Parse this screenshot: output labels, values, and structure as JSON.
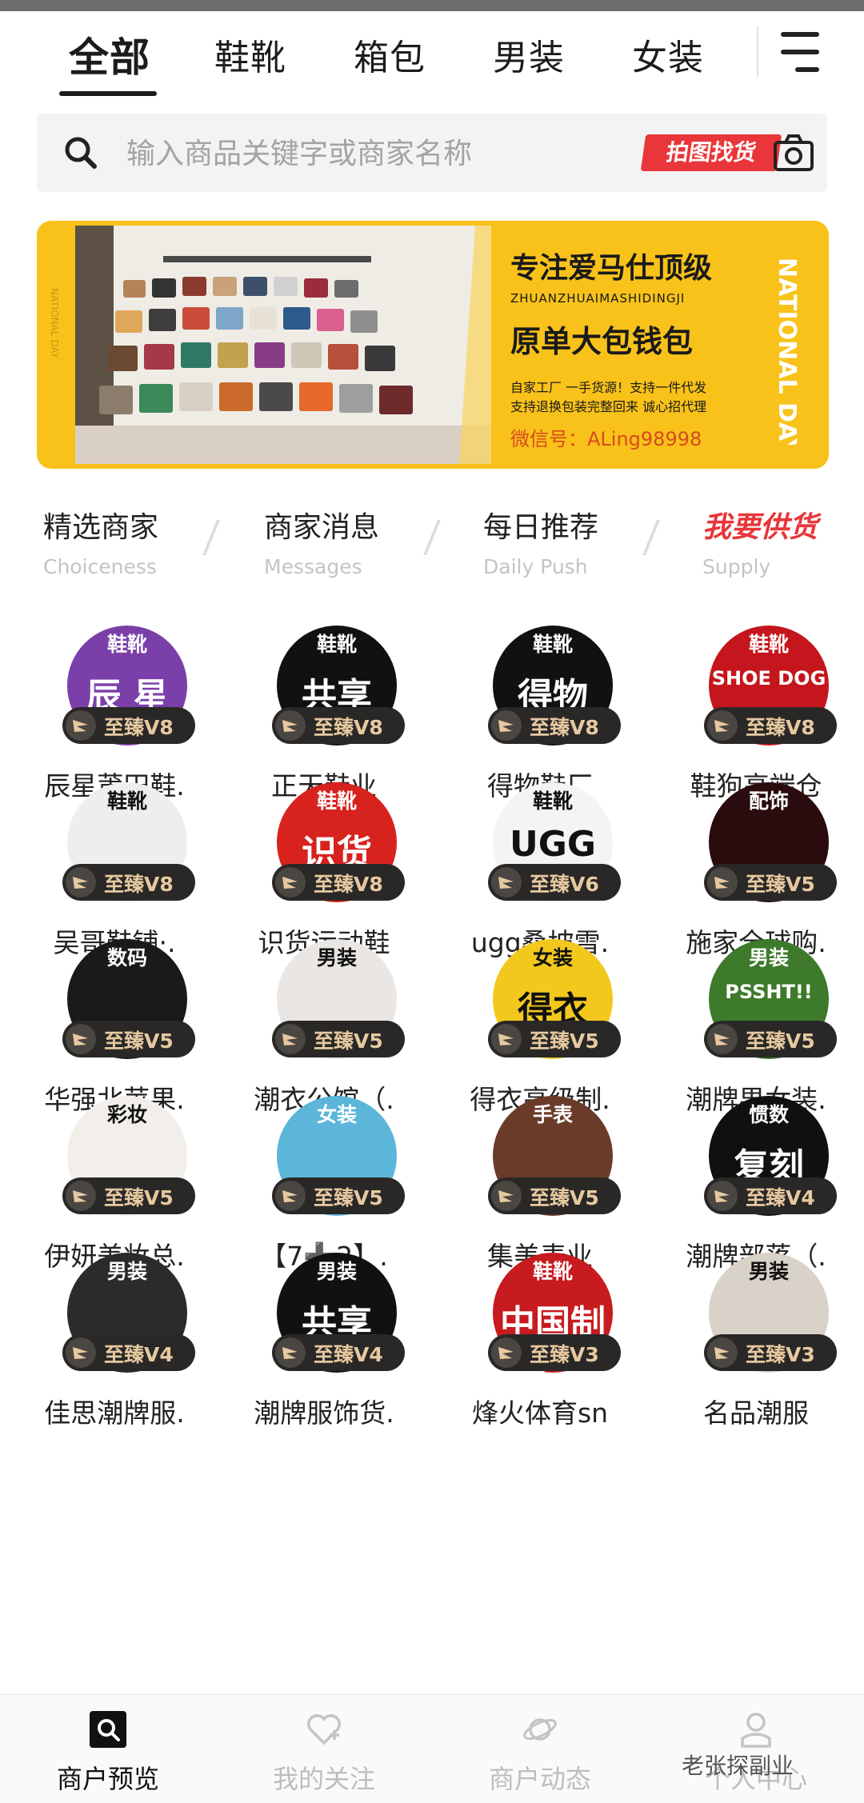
{
  "tabs": [
    {
      "label": "全部"
    },
    {
      "label": "鞋靴"
    },
    {
      "label": "箱包"
    },
    {
      "label": "男装"
    },
    {
      "label": "女装"
    }
  ],
  "search": {
    "placeholder": "输入商品关键字或商家名称",
    "photo_search_label": "拍图找货"
  },
  "banner": {
    "title": "专注爱马仕顶级",
    "pinyin": "ZHUANZHUAIMASHIDINGJI",
    "subtitle": "原单大包钱包",
    "desc1": "自家工厂 一手货源！支持一件代发",
    "desc2": "支持退换包装完整回来 诚心招代理",
    "wechat": "微信号：ALing98998",
    "side_text": "NATIONAL DAY",
    "side_text_left": "NATIONAL DAY"
  },
  "sections": [
    {
      "title": "精选商家",
      "sub": "Choiceness"
    },
    {
      "title": "商家消息",
      "sub": "Messages"
    },
    {
      "title": "每日推荐",
      "sub": "Daily Push"
    },
    {
      "title": "我要供货",
      "sub": "Supply"
    }
  ],
  "merchants": [
    {
      "name": "辰星莆田鞋.",
      "badge": "至臻V8",
      "tag": "鞋靴",
      "logo": "辰 星",
      "bg": "#7a3fa8"
    },
    {
      "name": "正天鞋业",
      "badge": "至臻V8",
      "tag": "鞋靴",
      "logo": "共享",
      "bg": "#111111"
    },
    {
      "name": "得物鞋厂",
      "badge": "至臻V8",
      "tag": "鞋靴",
      "logo": "得物",
      "bg": "#111111"
    },
    {
      "name": "鞋狗高端仓",
      "badge": "至臻V8",
      "tag": "鞋靴",
      "logo": "SHOE DOG",
      "bg": "#c4161c"
    },
    {
      "name": "吴哥鞋铺·.",
      "badge": "至臻V8",
      "tag": "鞋靴",
      "logo": "",
      "bg": "#eeeeee"
    },
    {
      "name": "识货运动鞋",
      "badge": "至臻V8",
      "tag": "鞋靴",
      "logo": "识货",
      "bg": "#d7221e"
    },
    {
      "name": "ugg桑坡雪.",
      "badge": "至臻V6",
      "tag": "鞋靴",
      "logo": "UGG",
      "bg": "#f4f4f4"
    },
    {
      "name": "施家全球购.",
      "badge": "至臻V5",
      "tag": "配饰",
      "logo": "",
      "bg": "#2a0c0e"
    },
    {
      "name": "华强北苹果.",
      "badge": "至臻V5",
      "tag": "数码",
      "logo": "",
      "bg": "#1a1a1a"
    },
    {
      "name": "潮衣公馆（.",
      "badge": "至臻V5",
      "tag": "男装",
      "logo": "",
      "bg": "#e9e6e3"
    },
    {
      "name": "得衣高级制.",
      "badge": "至臻V5",
      "tag": "女装",
      "logo": "得衣",
      "bg": "#f3c81d"
    },
    {
      "name": "潮牌男女装.",
      "badge": "至臻V5",
      "tag": "男装",
      "logo": "PSSHT!!",
      "bg": "#3d7a2c"
    },
    {
      "name": "伊妍美妆总.",
      "badge": "至臻V5",
      "tag": "彩妆",
      "logo": "",
      "bg": "#f2efea"
    },
    {
      "name": "【7➕2】.",
      "badge": "至臻V5",
      "tag": "女装",
      "logo": "",
      "bg": "#5bb6d9"
    },
    {
      "name": "集美表业",
      "badge": "至臻V5",
      "tag": "手表",
      "logo": "",
      "bg": "#6b3b2a"
    },
    {
      "name": "潮牌部落（.",
      "badge": "至臻V4",
      "tag": "惯数",
      "logo": "复刻",
      "bg": "#101010"
    },
    {
      "name": "佳思潮牌服.",
      "badge": "至臻V4",
      "tag": "男装",
      "logo": "",
      "bg": "#2b2b2b"
    },
    {
      "name": "潮牌服饰货.",
      "badge": "至臻V4",
      "tag": "男装",
      "logo": "共享",
      "bg": "#111111"
    },
    {
      "name": "烽火体育sn",
      "badge": "至臻V3",
      "tag": "鞋靴",
      "logo": "中国制造",
      "bg": "#c71b1f"
    },
    {
      "name": "名品潮服",
      "badge": "至臻V3",
      "tag": "男装",
      "logo": "",
      "bg": "#d9d2c8"
    }
  ],
  "bottom_nav": [
    {
      "label": "商户预览",
      "icon": "search-icon"
    },
    {
      "label": "我的关注",
      "icon": "heart-plus-icon"
    },
    {
      "label": "商户动态",
      "icon": "planet-icon"
    },
    {
      "label": "个人中心",
      "icon": "person-icon"
    }
  ],
  "watermark": "老张探副业",
  "colors": {
    "accent": "#e8363a",
    "banner_bg": "#f8c21a",
    "badge_bg": "#2a2827",
    "badge_text": "#e6c9a0"
  }
}
